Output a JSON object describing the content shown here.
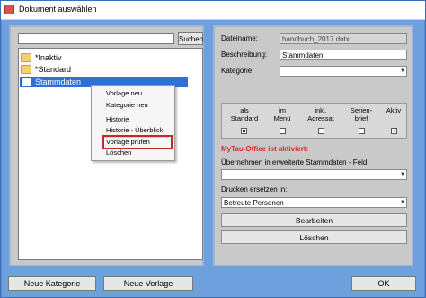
{
  "window": {
    "title": "Dokument auswählen"
  },
  "left": {
    "search": {
      "value": "",
      "button_label": "Suchen"
    },
    "tree": [
      {
        "label": "*Inaktiv",
        "type": "folder"
      },
      {
        "label": "*Standard",
        "type": "folder"
      },
      {
        "label": "Stammdaten",
        "type": "document",
        "selected": true
      }
    ],
    "context_menu": {
      "items": [
        "Vorlage neu",
        "Kategorie neu",
        "Historie",
        "Historie - Überblick",
        "Vorlage prüfen",
        "Löschen"
      ],
      "highlighted": "Vorlage prüfen"
    }
  },
  "right": {
    "filename_label": "Dateiname:",
    "filename_value": "handbuch_2017.dotx",
    "description_label": "Beschreibung:",
    "description_value": "Stammdaten",
    "category_label": "Kategorie:",
    "category_value": "",
    "options": [
      {
        "label_line1": "als",
        "label_line2": "Standard",
        "state": "filled"
      },
      {
        "label_line1": "im",
        "label_line2": "Menü",
        "state": "unchecked"
      },
      {
        "label_line1": "inkl.",
        "label_line2": "Adressat",
        "state": "unchecked"
      },
      {
        "label_line1": "Serien-",
        "label_line2": "brief",
        "state": "unchecked"
      },
      {
        "label_line1": "Aktiv",
        "label_line2": "",
        "state": "checked"
      }
    ],
    "mytau_notice": "MyTau-Office ist aktiviert:",
    "transfer_label": "Übernehmen in erweiterte Stammdaten - Feld:",
    "transfer_value": "",
    "print_label": "Drucken ersetzen in:",
    "print_value": "Betreute Personen",
    "edit_button": "Bearbeiten",
    "delete_button": "Löschen"
  },
  "footer": {
    "new_category": "Neue Kategorie",
    "new_template": "Neue Vorlage",
    "ok": "OK"
  }
}
